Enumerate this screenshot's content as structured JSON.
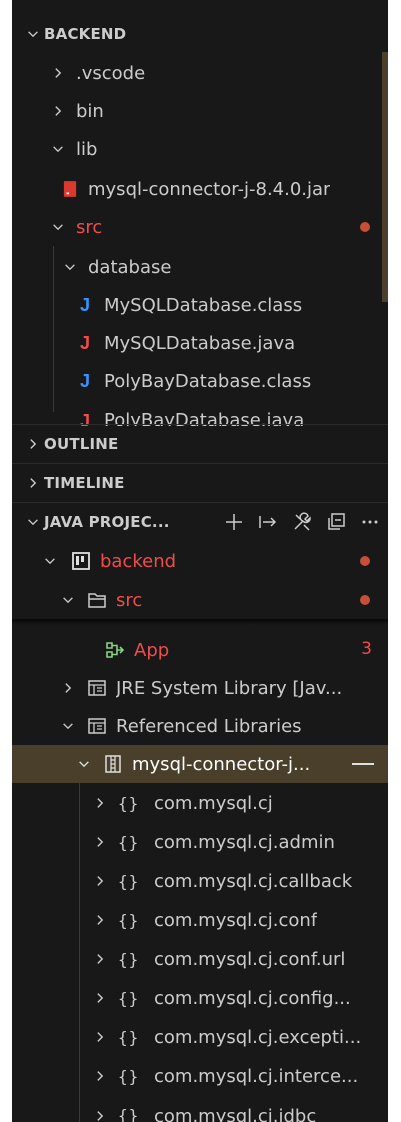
{
  "explorer": {
    "section_title": "BACKEND",
    "items": [
      {
        "label": ".vscode",
        "type": "folder-collapsed"
      },
      {
        "label": "bin",
        "type": "folder-collapsed"
      },
      {
        "label": "lib",
        "type": "folder-expanded"
      },
      {
        "label": "mysql-connector-j-8.4.0.jar",
        "type": "jar-file"
      },
      {
        "label": "src",
        "type": "folder-expanded",
        "modified": true
      },
      {
        "label": "database",
        "type": "folder-expanded"
      },
      {
        "label": "MySQLDatabase.class",
        "type": "class-file"
      },
      {
        "label": "MySQLDatabase.java",
        "type": "java-file"
      },
      {
        "label": "PolyBayDatabase.class",
        "type": "class-file"
      },
      {
        "label": "PolyBayDatabase.java",
        "type": "java-file"
      }
    ]
  },
  "outline": {
    "title": "OUTLINE"
  },
  "timeline": {
    "title": "TIMELINE"
  },
  "java_projects": {
    "title": "JAVA PROJEC...",
    "items": [
      {
        "label": "backend",
        "type": "project"
      },
      {
        "label": "src",
        "type": "source-folder"
      },
      {
        "label": "App",
        "type": "main-class",
        "badge": "3"
      },
      {
        "label": "JRE System Library [Jav...",
        "type": "library"
      },
      {
        "label": "Referenced Libraries",
        "type": "library"
      },
      {
        "label": "mysql-connector-j...",
        "type": "jar"
      }
    ],
    "packages": [
      "com.mysql.cj",
      "com.mysql.cj.admin",
      "com.mysql.cj.callback",
      "com.mysql.cj.conf",
      "com.mysql.cj.conf.url",
      "com.mysql.cj.config...",
      "com.mysql.cj.excepti...",
      "com.mysql.cj.interce...",
      "com.mysql.cj.jdbc"
    ],
    "package_glyph": "{}"
  },
  "colors": {
    "background": "#181818",
    "text": "#cccccc",
    "modified": "#f14c4c",
    "java_blue": "#3794ff",
    "java_red": "#f14c4c",
    "main_class_green": "#89d185",
    "selection": "#4a3f2a"
  }
}
